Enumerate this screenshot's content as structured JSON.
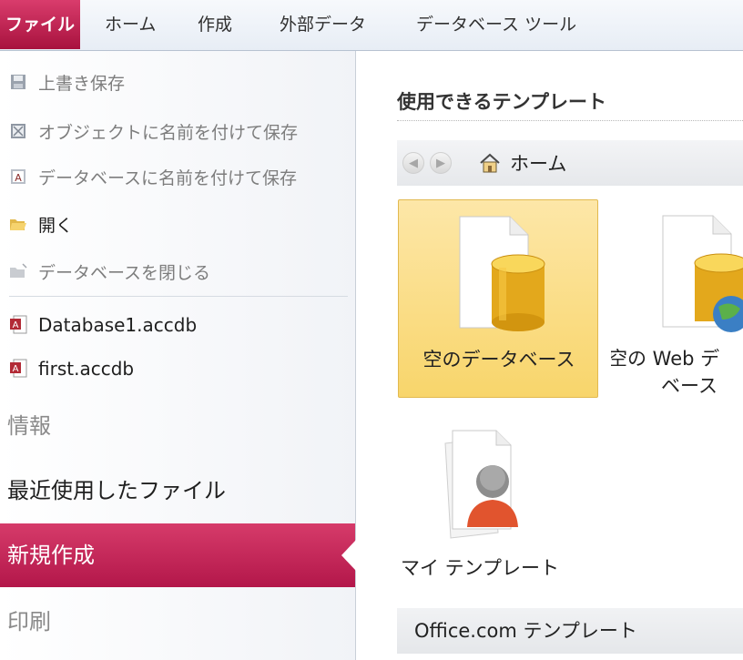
{
  "ribbon": {
    "tabs": [
      "ファイル",
      "ホーム",
      "作成",
      "外部データ",
      "データベース ツール"
    ]
  },
  "nav": {
    "commands": [
      {
        "label": "上書き保存",
        "icon": "save-icon"
      },
      {
        "label": "オブジェクトに名前を付けて保存",
        "icon": "save-object-icon"
      },
      {
        "label": "データベースに名前を付けて保存",
        "icon": "save-database-icon"
      },
      {
        "label": "開く",
        "icon": "open-folder-icon"
      },
      {
        "label": "データベースを閉じる",
        "icon": "close-database-icon"
      }
    ],
    "recent_files": [
      "Database1.accdb",
      "first.accdb"
    ],
    "sections": {
      "info": "情報",
      "recent": "最近使用したファイル",
      "new": "新規作成",
      "print": "印刷"
    }
  },
  "main": {
    "title": "使用できるテンプレート",
    "breadcrumb": "ホーム",
    "templates": [
      {
        "label": "空のデータベース"
      },
      {
        "label_line1": "空の Web デ",
        "label_line2": "ベース"
      },
      {
        "label": "マイ テンプレート"
      }
    ],
    "office_section": "Office.com テンプレート"
  },
  "colors": {
    "accent": "#c1194b",
    "tile_selected": "#f9d979"
  }
}
